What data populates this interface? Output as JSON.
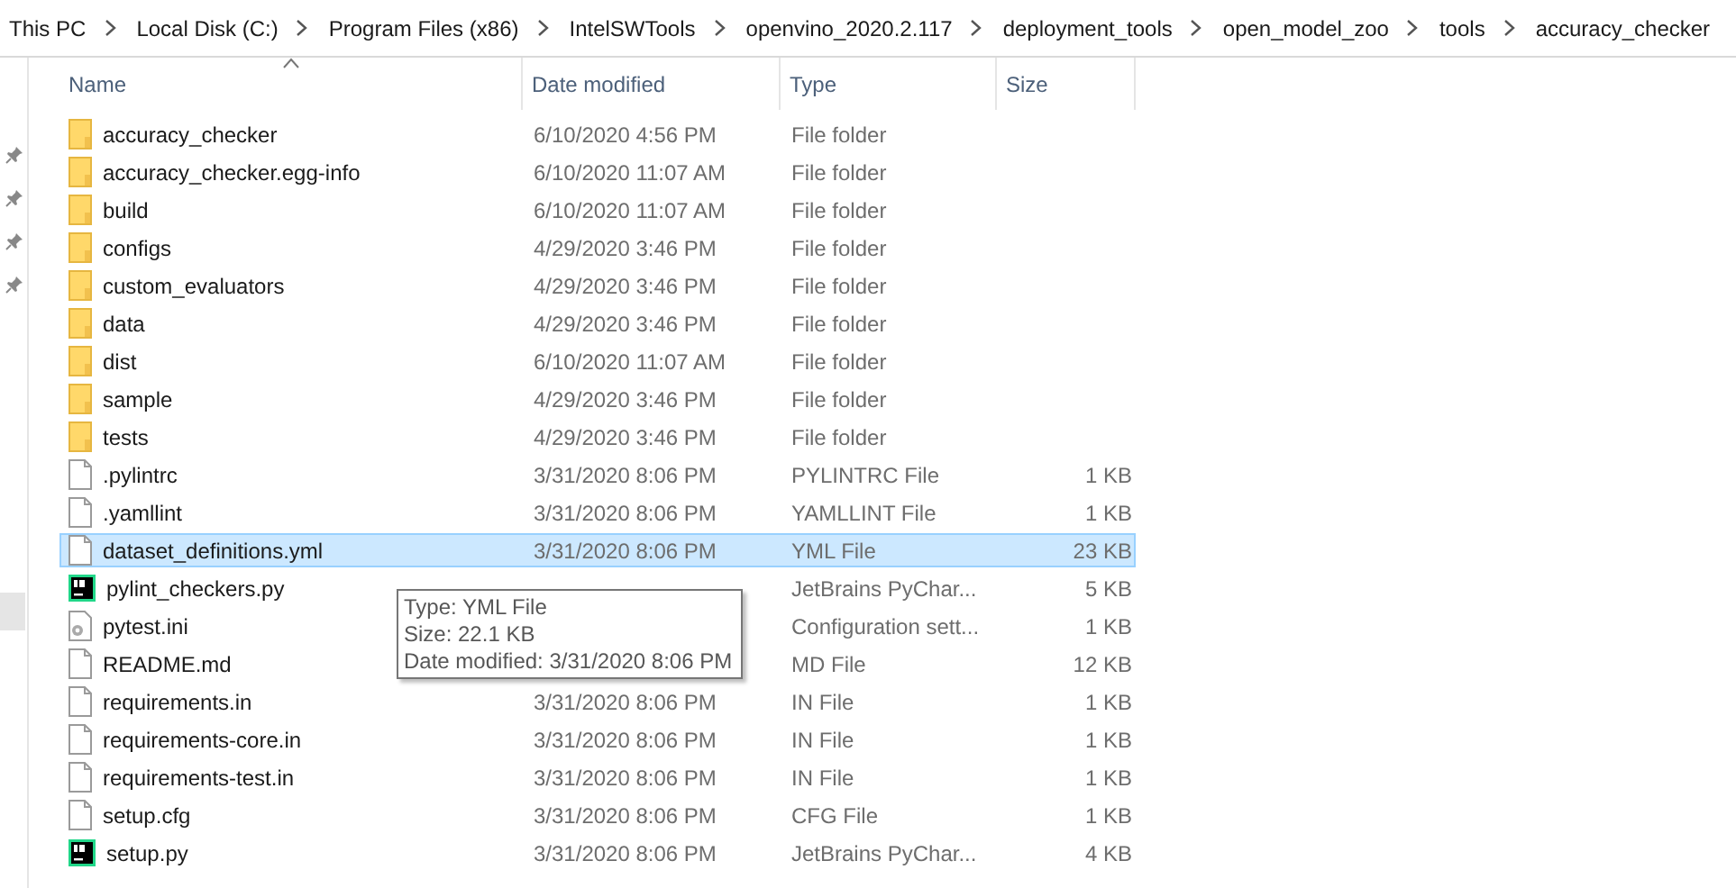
{
  "breadcrumb": [
    "This PC",
    "Local Disk (C:)",
    "Program Files (x86)",
    "IntelSWTools",
    "openvino_2020.2.117",
    "deployment_tools",
    "open_model_zoo",
    "tools",
    "accuracy_checker"
  ],
  "columns": [
    {
      "label": "Name",
      "sorted": true
    },
    {
      "label": "Date modified",
      "sorted": false
    },
    {
      "label": "Type",
      "sorted": false
    },
    {
      "label": "Size",
      "sorted": false
    }
  ],
  "rows": [
    {
      "kind": "folder",
      "name": "accuracy_checker",
      "date": "6/10/2020 4:56 PM",
      "type": "File folder",
      "selected": false
    },
    {
      "kind": "folder",
      "name": "accuracy_checker.egg-info",
      "date": "6/10/2020 11:07 AM",
      "type": "File folder",
      "selected": false
    },
    {
      "kind": "folder",
      "name": "build",
      "date": "6/10/2020 11:07 AM",
      "type": "File folder",
      "selected": false
    },
    {
      "kind": "folder",
      "name": "configs",
      "date": "4/29/2020 3:46 PM",
      "type": "File folder",
      "selected": false
    },
    {
      "kind": "folder",
      "name": "custom_evaluators",
      "date": "4/29/2020 3:46 PM",
      "type": "File folder",
      "selected": false
    },
    {
      "kind": "folder",
      "name": "data",
      "date": "4/29/2020 3:46 PM",
      "type": "File folder",
      "selected": false
    },
    {
      "kind": "folder",
      "name": "dist",
      "date": "6/10/2020 11:07 AM",
      "type": "File folder",
      "selected": false
    },
    {
      "kind": "folder",
      "name": "sample",
      "date": "4/29/2020 3:46 PM",
      "type": "File folder",
      "selected": false
    },
    {
      "kind": "folder",
      "name": "tests",
      "date": "4/29/2020 3:46 PM",
      "type": "File folder",
      "selected": false
    },
    {
      "kind": "file",
      "name": ".pylintrc",
      "date": "3/31/2020 8:06 PM",
      "type": "PYLINTRC File",
      "size": "1 KB",
      "selected": false
    },
    {
      "kind": "file",
      "name": ".yamllint",
      "date": "3/31/2020 8:06 PM",
      "type": "YAMLLINT File",
      "size": "1 KB",
      "selected": false
    },
    {
      "kind": "file",
      "name": "dataset_definitions.yml",
      "date": "3/31/2020 8:06 PM",
      "type": "YML File",
      "size": "23 KB",
      "selected": true
    },
    {
      "kind": "pycharm",
      "name": "pylint_checkers.py",
      "type": "JetBrains PyChar...",
      "size": "5 KB",
      "selected": false
    },
    {
      "kind": "settings",
      "name": "pytest.ini",
      "type": "Configuration sett...",
      "size": "1 KB",
      "selected": false
    },
    {
      "kind": "file",
      "name": "README.md",
      "type": "MD File",
      "size": "12 KB",
      "selected": false
    },
    {
      "kind": "file",
      "name": "requirements.in",
      "date": "3/31/2020 8:06 PM",
      "type": "IN File",
      "size": "1 KB",
      "selected": false
    },
    {
      "kind": "file",
      "name": "requirements-core.in",
      "date": "3/31/2020 8:06 PM",
      "type": "IN File",
      "size": "1 KB",
      "selected": false
    },
    {
      "kind": "file",
      "name": "requirements-test.in",
      "date": "3/31/2020 8:06 PM",
      "type": "IN File",
      "size": "1 KB",
      "selected": false
    },
    {
      "kind": "file",
      "name": "setup.cfg",
      "date": "3/31/2020 8:06 PM",
      "type": "CFG File",
      "size": "1 KB",
      "selected": false
    },
    {
      "kind": "pycharm",
      "name": "setup.py",
      "date": "3/31/2020 8:06 PM",
      "type": "JetBrains PyChar...",
      "size": "4 KB",
      "selected": false
    }
  ],
  "tooltip": [
    "Type: YML File",
    "Size: 22.1 KB",
    "Date modified: 3/31/2020 8:06 PM"
  ]
}
